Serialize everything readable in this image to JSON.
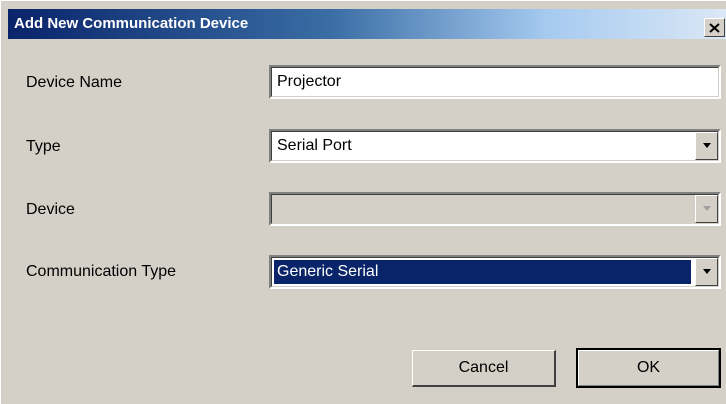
{
  "window": {
    "title": "Add New Communication Device"
  },
  "form": {
    "device_name": {
      "label": "Device Name",
      "value": "Projector"
    },
    "type": {
      "label": "Type",
      "value": "Serial Port"
    },
    "device": {
      "label": "Device",
      "value": ""
    },
    "communication_type": {
      "label": "Communication Type",
      "value": "Generic Serial"
    }
  },
  "buttons": {
    "cancel": "Cancel",
    "ok": "OK"
  },
  "colors": {
    "dialog_bg": "#d4d0c8",
    "title_dark": "#0a246a",
    "selection": "#0a246a"
  },
  "icons": {
    "close": "close-icon",
    "dropdown": "chevron-down-icon"
  }
}
